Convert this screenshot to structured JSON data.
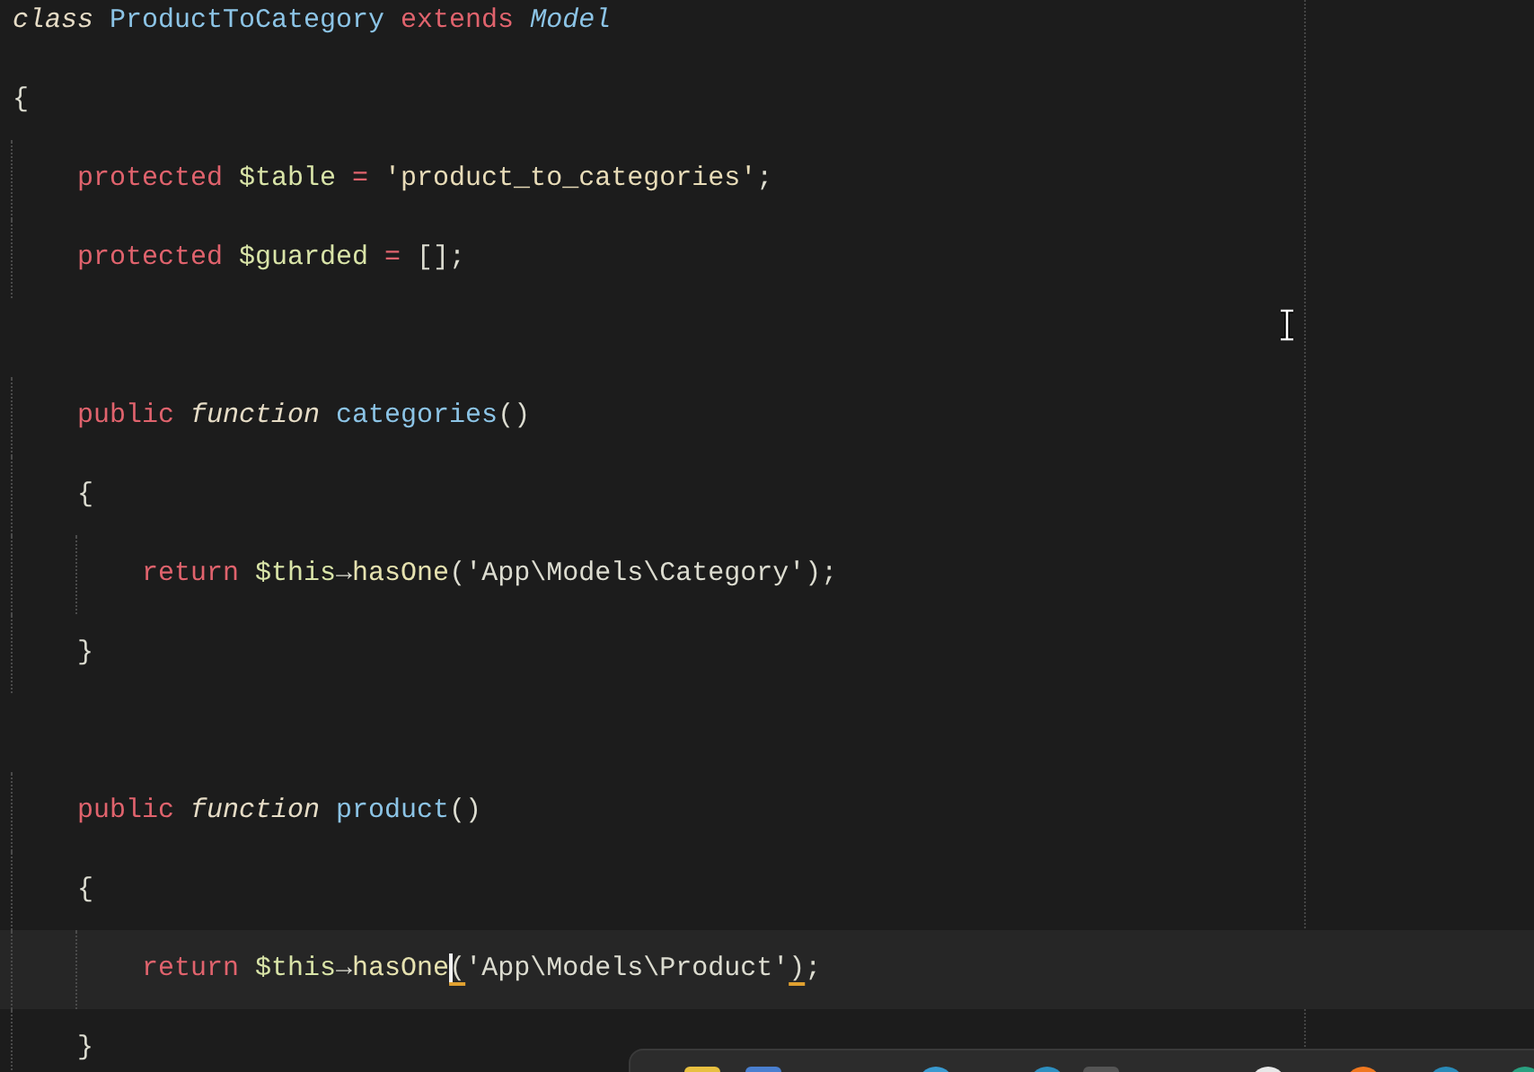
{
  "editor": {
    "lines": [
      {
        "highlighted": false,
        "tokens": [
          {
            "text": "class",
            "kind": "storage"
          },
          {
            "text": " ProductToCategory",
            "kind": "type"
          },
          {
            "text": " extends",
            "kind": "keyword"
          },
          {
            "text": " Model",
            "kind": "parent"
          }
        ]
      },
      {
        "highlighted": false,
        "tokens": [
          {
            "text": "{",
            "kind": "plain"
          }
        ]
      },
      {
        "highlighted": false,
        "tokens": [
          {
            "text": "    protected",
            "kind": "keyword"
          },
          {
            "text": " $table",
            "kind": "variable"
          },
          {
            "text": " =",
            "kind": "keyword"
          },
          {
            "text": " 'product_to_categories'",
            "kind": "string"
          },
          {
            "text": ";",
            "kind": "plain"
          }
        ]
      },
      {
        "highlighted": false,
        "tokens": [
          {
            "text": "    protected",
            "kind": "keyword"
          },
          {
            "text": " $guarded",
            "kind": "variable"
          },
          {
            "text": " =",
            "kind": "keyword"
          },
          {
            "text": " [];",
            "kind": "plain"
          }
        ]
      },
      {
        "highlighted": false
      },
      {
        "highlighted": false,
        "tokens": [
          {
            "text": "    public",
            "kind": "keyword"
          },
          {
            "text": " function",
            "kind": "storage"
          },
          {
            "text": " categories",
            "kind": "function"
          },
          {
            "text": "()",
            "kind": "plain"
          }
        ]
      },
      {
        "highlighted": false,
        "tokens": [
          {
            "text": "    {",
            "kind": "plain"
          }
        ]
      },
      {
        "highlighted": false,
        "tokens": [
          {
            "text": "        return",
            "kind": "keyword"
          },
          {
            "text": " $this",
            "kind": "variable"
          },
          {
            "text": "→",
            "kind": "plain"
          },
          {
            "text": "hasOne",
            "kind": "method"
          },
          {
            "text": "('App\\Models\\Category');",
            "kind": "plain"
          }
        ]
      },
      {
        "highlighted": false,
        "tokens": [
          {
            "text": "    }",
            "kind": "plain"
          }
        ]
      },
      {
        "highlighted": false
      },
      {
        "highlighted": false,
        "tokens": [
          {
            "text": "    public",
            "kind": "keyword"
          },
          {
            "text": " function",
            "kind": "storage"
          },
          {
            "text": " product",
            "kind": "function"
          },
          {
            "text": "()",
            "kind": "plain"
          }
        ]
      },
      {
        "highlighted": false,
        "tokens": [
          {
            "text": "    {",
            "kind": "plain"
          }
        ]
      },
      {
        "highlighted": true,
        "tokens": [
          {
            "text": "        return",
            "kind": "keyword"
          },
          {
            "text": " $this",
            "kind": "variable"
          },
          {
            "text": "→",
            "kind": "plain"
          },
          {
            "text": "hasOne",
            "kind": "method"
          },
          {
            "text": "(",
            "kind": "plain",
            "matched": true,
            "cursor": true
          },
          {
            "text": "'App\\Models\\Product'",
            "kind": "plain"
          },
          {
            "text": ")",
            "kind": "plain",
            "matched": true
          },
          {
            "text": ";",
            "kind": "plain"
          }
        ]
      },
      {
        "highlighted": false,
        "tokens": [
          {
            "text": "    }",
            "kind": "plain"
          }
        ]
      }
    ]
  }
}
